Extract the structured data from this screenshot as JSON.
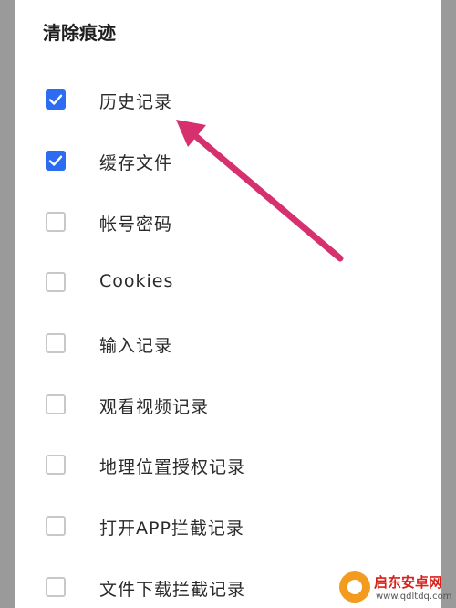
{
  "dialog": {
    "title": "清除痕迹",
    "items": [
      {
        "label": "历史记录",
        "checked": true
      },
      {
        "label": "缓存文件",
        "checked": true
      },
      {
        "label": "帐号密码",
        "checked": false
      },
      {
        "label": "Cookies",
        "checked": false
      },
      {
        "label": "输入记录",
        "checked": false
      },
      {
        "label": "观看视频记录",
        "checked": false
      },
      {
        "label": "地理位置授权记录",
        "checked": false
      },
      {
        "label": "打开APP拦截记录",
        "checked": false
      },
      {
        "label": "文件下载拦截记录",
        "checked": false
      }
    ]
  },
  "annotation": {
    "color": "#d6306e",
    "icon": "arrow-icon"
  },
  "colors": {
    "accent": "#2b6cf2",
    "checkbox_border": "#c8c8c8"
  },
  "watermark": {
    "name": "启东安卓网",
    "url": "www.qdltdq.com"
  }
}
